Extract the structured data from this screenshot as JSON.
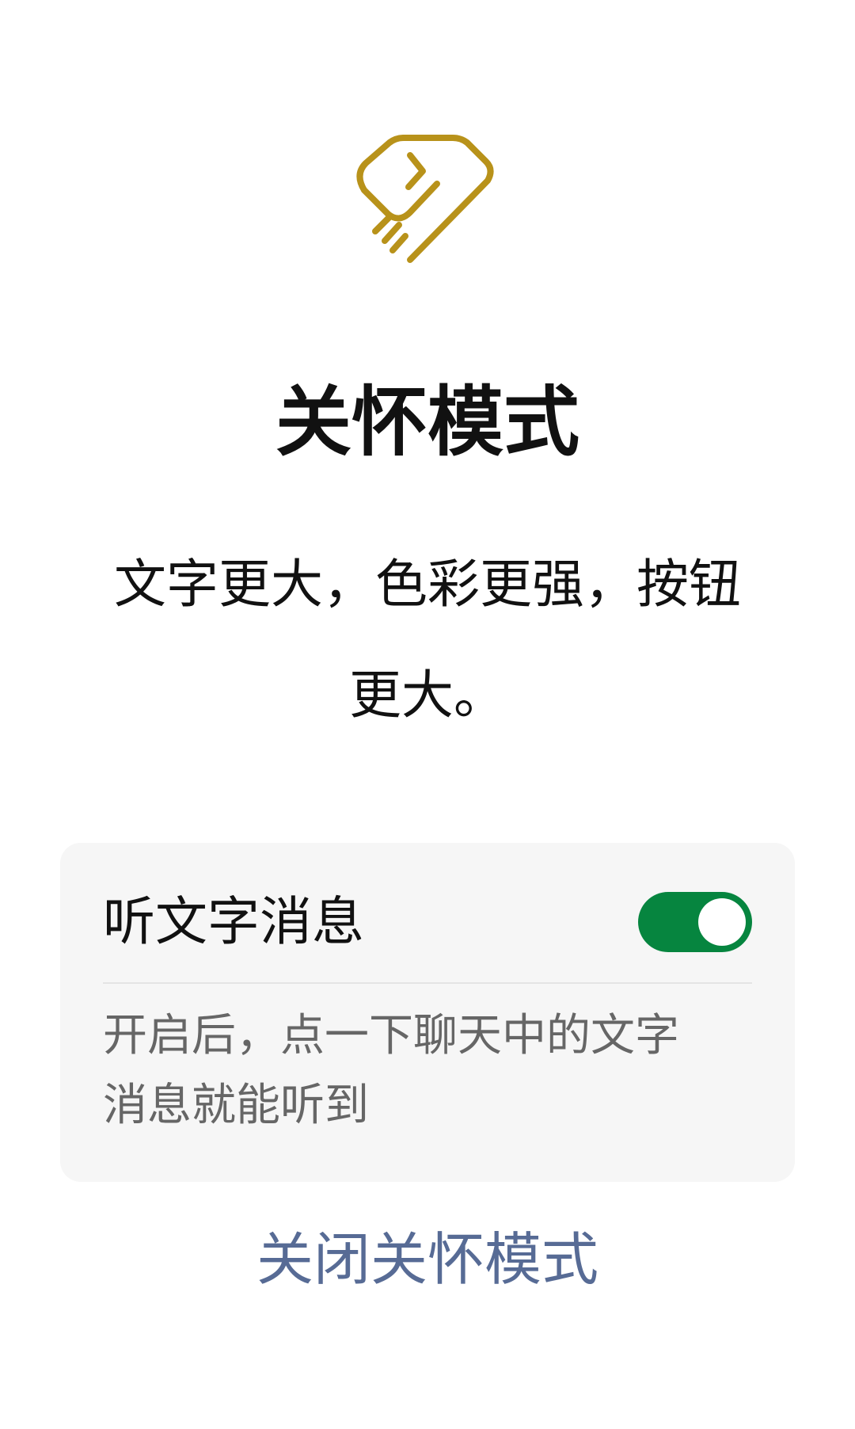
{
  "header": {
    "logo_icon": "heart-hand-icon",
    "logo_color": "#b8921a",
    "title": "关怀模式"
  },
  "description": {
    "line1": "文字更大，色彩更强，按钮",
    "line2": "更大。"
  },
  "listen_card": {
    "label": "听文字消息",
    "toggle_on": true,
    "toggle_color": "#06853f",
    "note_line1": "开启后，点一下聊天中的文字",
    "note_line2": "消息就能听到"
  },
  "footer": {
    "close_label": "关闭关怀模式",
    "link_color": "#576b95"
  }
}
